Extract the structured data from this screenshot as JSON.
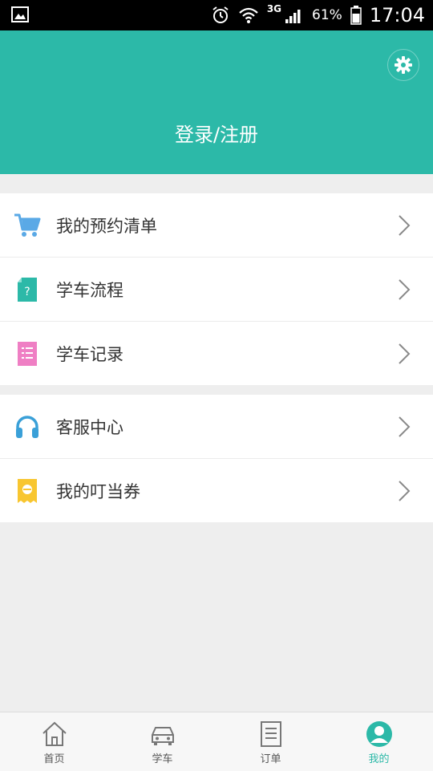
{
  "status_bar": {
    "network": "3G",
    "battery": "61%",
    "time": "17:04"
  },
  "header": {
    "login_text": "登录/注册"
  },
  "menu_group_1": [
    {
      "label": "我的预约清单",
      "icon": "cart-icon"
    },
    {
      "label": "学车流程",
      "icon": "document-question-icon"
    },
    {
      "label": "学车记录",
      "icon": "list-record-icon"
    }
  ],
  "menu_group_2": [
    {
      "label": "客服中心",
      "icon": "headphones-icon"
    },
    {
      "label": "我的叮当券",
      "icon": "coupon-icon"
    }
  ],
  "tabs": [
    {
      "label": "首页",
      "icon": "home-icon"
    },
    {
      "label": "学车",
      "icon": "car-icon"
    },
    {
      "label": "订单",
      "icon": "order-icon"
    },
    {
      "label": "我的",
      "icon": "profile-icon",
      "active": true
    }
  ],
  "colors": {
    "accent": "#2cb9a8",
    "cart_blue": "#5aa9e6",
    "pink": "#ef7fc4",
    "yellow": "#f8c630"
  }
}
